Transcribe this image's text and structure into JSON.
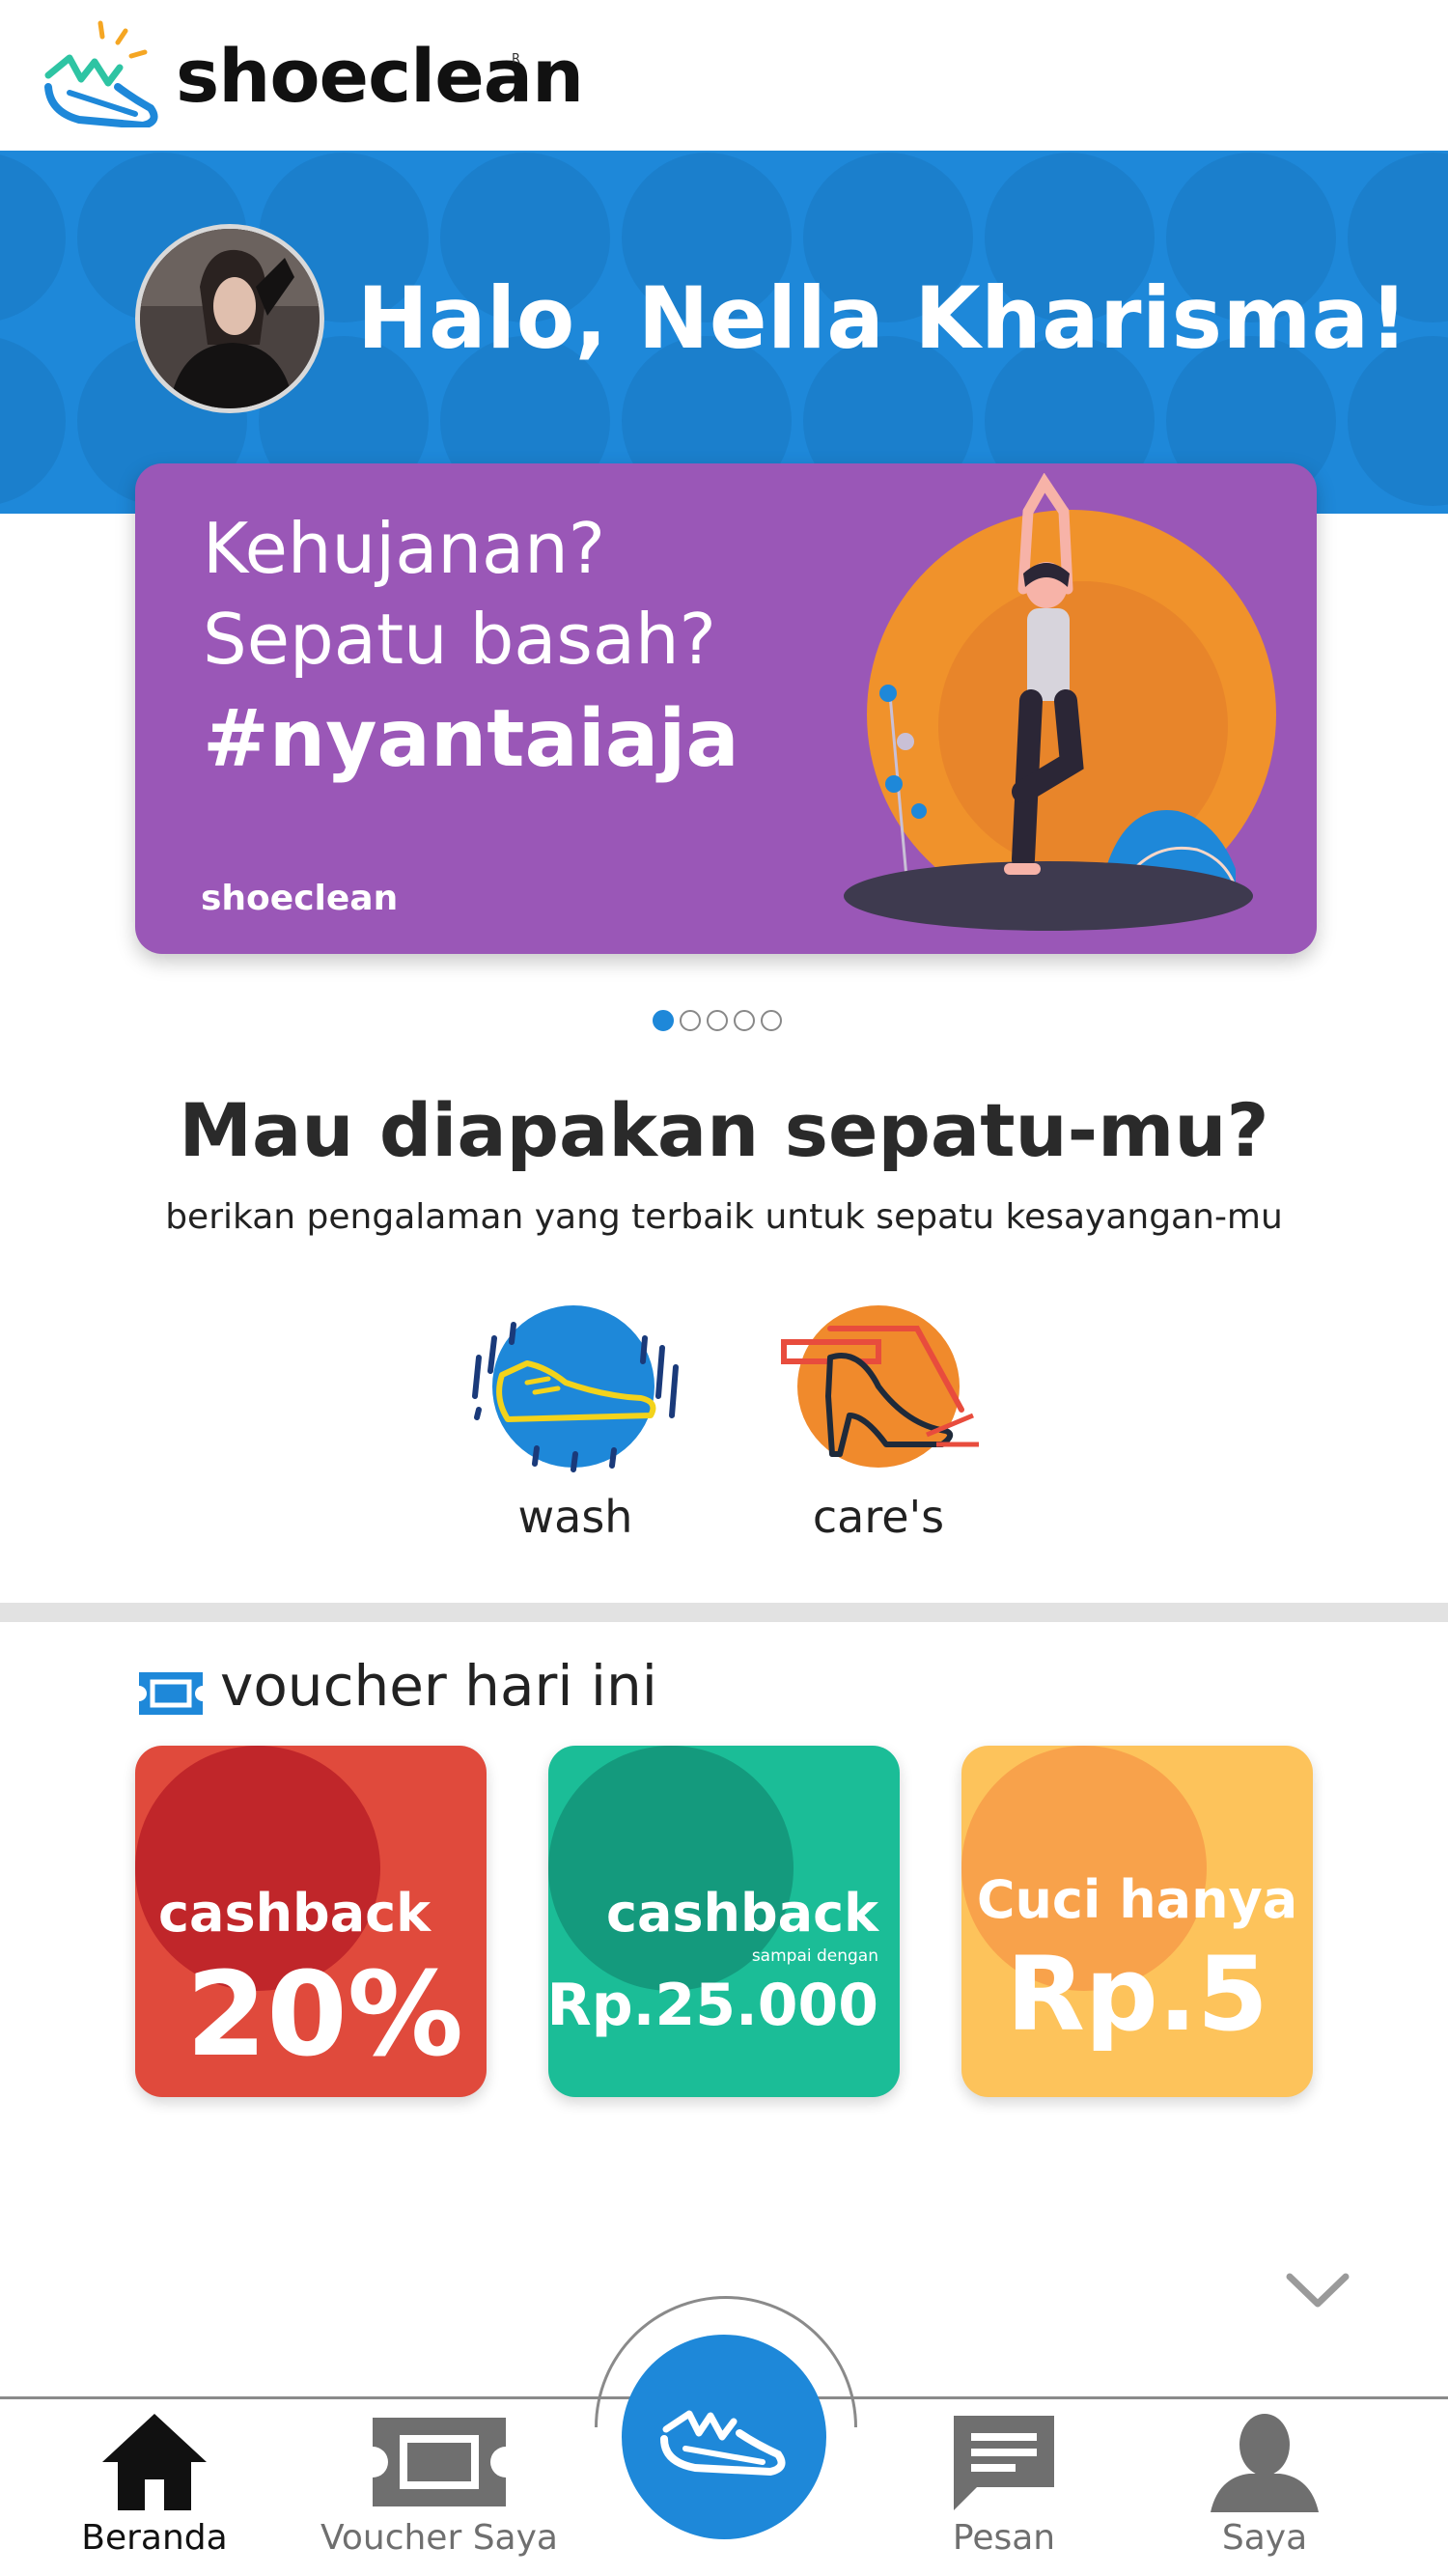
{
  "header": {
    "brand": "shoeclean",
    "reg_mark": "R",
    "logo_icon": "shoe-sparkle-icon"
  },
  "hero": {
    "greeting": "Halo, Nella Kharisma!",
    "band_color": "#1e88d9"
  },
  "promo": {
    "line1": "Kehujanan?",
    "line2": "Sepatu basah?",
    "tag": "#nyantaiaja",
    "brand": "shoeclean",
    "background": "#9a57b7",
    "slides_total": 5,
    "slide_active": 1
  },
  "services": {
    "title": "Mau diapakan sepatu-mu?",
    "subtitle": "berikan pengalaman yang terbaik untuk sepatu kesayangan-mu",
    "items": [
      {
        "label": "wash",
        "icon": "sneaker-wash-icon",
        "color": "#1e88d9"
      },
      {
        "label": "care's",
        "icon": "high-heel-care-icon",
        "color": "#f08a2c"
      }
    ]
  },
  "vouchers": {
    "title": "voucher hari ini",
    "icon": "ticket-icon",
    "items": [
      {
        "label": "cashback",
        "value": "20%",
        "color": "#e04a3c"
      },
      {
        "label": "cashback",
        "sub": "sampai dengan",
        "value": "Rp.25.000",
        "color": "#1bbd97"
      },
      {
        "label": "Cuci hanya",
        "value": "Rp.5",
        "color": "#fdc35b"
      }
    ]
  },
  "bottom_nav": {
    "items": [
      {
        "label": "Beranda",
        "icon": "home-icon",
        "active": true
      },
      {
        "label": "Voucher Saya",
        "icon": "ticket-icon"
      },
      {
        "label": "",
        "icon": "shoe-icon"
      },
      {
        "label": "Pesan",
        "icon": "message-icon"
      },
      {
        "label": "Saya",
        "icon": "user-icon"
      }
    ]
  }
}
